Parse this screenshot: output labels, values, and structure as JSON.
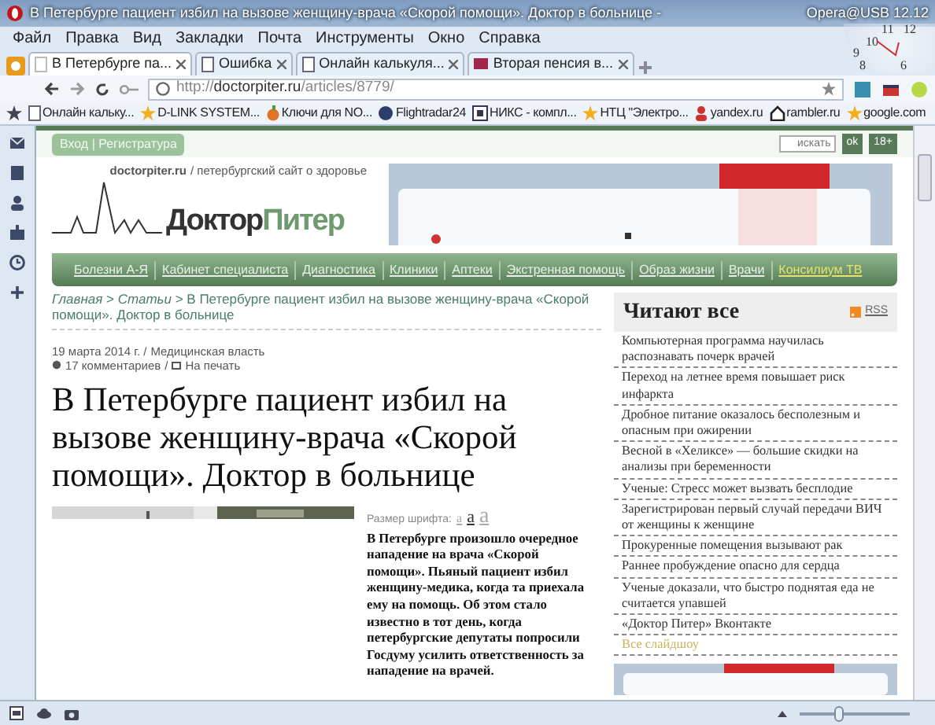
{
  "window": {
    "title": "В Петербурге пациент избил на вызове женщину-врача «Скорой помощи». Доктор в больнице -",
    "app": "Opera@USB 12.12"
  },
  "clock": {
    "numbers": [
      "11",
      "12",
      "10",
      "9",
      "8",
      "6"
    ]
  },
  "menu": [
    "Файл",
    "Правка",
    "Вид",
    "Закладки",
    "Почта",
    "Инструменты",
    "Окно",
    "Справка"
  ],
  "tabs": [
    {
      "label": "В Петербурге па...",
      "selected": true
    },
    {
      "label": "Ошибка",
      "selected": false
    },
    {
      "label": "Онлайн калькуля...",
      "selected": false
    },
    {
      "label": "Вторая пенсия в...",
      "selected": false
    }
  ],
  "address": {
    "host": "doctorpiter.ru",
    "prefix": "http://",
    "path": "/articles/8779/"
  },
  "bookmarks": [
    "Онлайн кальку...",
    "D-LINK SYSTEM...",
    "Ключи для NO...",
    "Flightradar24",
    "НИКС - компл...",
    "НТЦ \"Электро...",
    "yandex.ru",
    "rambler.ru",
    "google.com"
  ],
  "site": {
    "login": "Вход | Регистратура",
    "search": {
      "placeholder": "искать"
    },
    "ok": "ok",
    "age": "18+",
    "domain": "doctorpiter.ru",
    "tagline": "/ петербургский сайт о здоровье",
    "logo_a": "Доктор",
    "logo_b": "Питер",
    "nav": [
      {
        "label": "Болезни А-Я",
        "highlight": false
      },
      {
        "label": "Кабинет специалиста",
        "highlight": false
      },
      {
        "label": "Диагностика",
        "highlight": false
      },
      {
        "label": "Клиники",
        "highlight": false
      },
      {
        "label": "Аптеки",
        "highlight": false
      },
      {
        "label": "Экстренная помощь",
        "highlight": false
      },
      {
        "label": "Образ жизни",
        "highlight": false
      },
      {
        "label": "Врачи",
        "highlight": false
      },
      {
        "label": "Консилиум ТВ",
        "highlight": true
      }
    ]
  },
  "article": {
    "breadcrumb": "*Главная* > *Статьи* > В Петербурге пациент избил на вызове женщину-врача «Скорой помощи». Доктор в больнице",
    "date": "19 марта 2014 г. /",
    "category": "Медицинская власть",
    "comments": "17 комментариев",
    "sep": "/",
    "print": "На печать",
    "headline": "В Петербурге пациент избил на вызове женщину-врача «Скорой помощи». Доктор в больнице",
    "font_size_label": "Размер шрифта:",
    "font_sizes": [
      {
        "label": "а",
        "selected": false
      },
      {
        "label": "а",
        "selected": true
      },
      {
        "label": "а",
        "selected": false
      }
    ],
    "lead": "В Петербурге произошло очередное нападение на врача «Скорой помощи». Пьяный пациент избил женщину-медика, когда та приехала ему на помощь. Об этом стало известно в тот день, когда петербургские депутаты попросили Госдуму усилить ответственность за нападение на врачей."
  },
  "sidebar": {
    "title": "Читают все",
    "rss": "RSS",
    "items": [
      {
        "label": "Компьютерная программа научилась распознавать почерк врачей",
        "kind": "article"
      },
      {
        "label": "Переход на летнее время повышает риск инфаркта",
        "kind": "article"
      },
      {
        "label": "Дробное питание оказалось бесполезным и опасным при ожирении",
        "kind": "article"
      },
      {
        "label": "Весной в «Хеликсе» — большие скидки на анализы при беременности",
        "kind": "article"
      },
      {
        "label": "Ученые: Стресс может вызвать бесплодие",
        "kind": "article"
      },
      {
        "label": "Зарегистрирован первый случай передачи ВИЧ от женщины к женщине",
        "kind": "article"
      },
      {
        "label": "Прокуренные помещения вызывают рак",
        "kind": "article"
      },
      {
        "label": "Раннее пробуждение опасно для сердца",
        "kind": "article"
      },
      {
        "label": "Ученые доказали, что быстро поднятая еда не считается упавшей",
        "kind": "article"
      },
      {
        "label": "«Доктор Питер» Вконтакте",
        "kind": "article"
      },
      {
        "label": "Все слайдшоу",
        "kind": "more"
      }
    ]
  },
  "status_bar": {
    "zoom": {
      "level": 0.35
    }
  }
}
